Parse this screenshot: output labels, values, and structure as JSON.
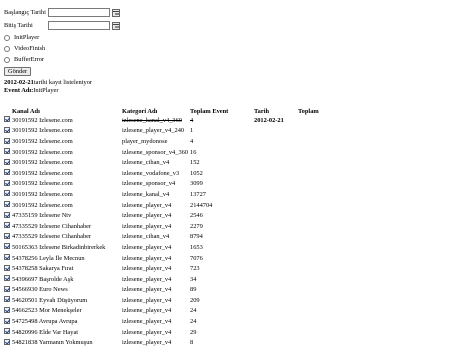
{
  "form": {
    "start_label": "Başlangıç Tarihi",
    "start_value": "",
    "end_label": "Bitiş Tarihi",
    "end_value": "",
    "radios": [
      "InitPlayer",
      "VideoFinish",
      "BufferError"
    ],
    "submit_label": "Gönder"
  },
  "summary": {
    "listing_prefix": "2012-02-21",
    "listing_suffix": " tarihi kayıt listeleniyor",
    "event_label": "Event Adı:",
    "event_value": " InitPlayer"
  },
  "table": {
    "headers": [
      "Kanal Adı",
      "Kategori Adı",
      "Toplam Event",
      "Tarih",
      "Toplam"
    ],
    "date": "2012-02-21",
    "rows": [
      {
        "kanal": "30191592 Izlesene.com",
        "kategori": "izlesene_kanal_v4_360",
        "toplam": "4",
        "struck": true
      },
      {
        "kanal": "30191592 Izlesene.com",
        "kategori": "izlesene_player_v4_240",
        "toplam": "1"
      },
      {
        "kanal": "30191592 Izlesene.com",
        "kategori": "player_mydonose",
        "toplam": "4"
      },
      {
        "kanal": "30191592 Izlesene.com",
        "kategori": "izlesene_sponsor_v4_360",
        "toplam": "16"
      },
      {
        "kanal": "30191592 Izlesene.com",
        "kategori": "izlesene_cihan_v4",
        "toplam": "152"
      },
      {
        "kanal": "30191592 Izlesene.com",
        "kategori": "izlesene_vodafone_v3",
        "toplam": "1052"
      },
      {
        "kanal": "30191592 Izlesene.com",
        "kategori": "izlesene_sponsor_v4",
        "toplam": "3099"
      },
      {
        "kanal": "30191592 Izlesene.com",
        "kategori": "izlesene_kanal_v4",
        "toplam": "13727"
      },
      {
        "kanal": "30191592 Izlesene.com",
        "kategori": "izlesene_player_v4",
        "toplam": "2144704"
      },
      {
        "kanal": "47335159 Izlesene Ntv",
        "kategori": "izlesene_player_v4",
        "toplam": "2546"
      },
      {
        "kanal": "47335529 Izlesene Cihanhaber",
        "kategori": "izlesene_player_v4",
        "toplam": "2279"
      },
      {
        "kanal": "47335529 Izlesene Cihanhaber",
        "kategori": "izlesene_cihan_v4",
        "toplam": "8794"
      },
      {
        "kanal": "50165363 Izlesene Birkadinbirerkek",
        "kategori": "izlesene_player_v4",
        "toplam": "1653"
      },
      {
        "kanal": "54378256 Leyla İle Mecnun",
        "kategori": "izlesene_player_v4",
        "toplam": "7076"
      },
      {
        "kanal": "54378258 Sakarya Fırat",
        "kategori": "izlesene_player_v4",
        "toplam": "723"
      },
      {
        "kanal": "54396697 Başrolde Aşk",
        "kategori": "izlesene_player_v4",
        "toplam": "34"
      },
      {
        "kanal": "54566930 Euro News",
        "kategori": "izlesene_player_v4",
        "toplam": "89"
      },
      {
        "kanal": "54620501 Eyvah Düşüyorum",
        "kategori": "izlesene_player_v4",
        "toplam": "209"
      },
      {
        "kanal": "54662523 Mor Menekşeler",
        "kategori": "izlesene_player_v4",
        "toplam": "24"
      },
      {
        "kanal": "54725498 Avrupa Avrupa",
        "kategori": "izlesene_player_v4",
        "toplam": "24"
      },
      {
        "kanal": "54820996 Elde Var Hayat",
        "kategori": "izlesene_player_v4",
        "toplam": "29"
      },
      {
        "kanal": "54821838 Yarmanın Yokmuşun",
        "kategori": "izlesene_player_v4",
        "toplam": "8"
      }
    ]
  }
}
